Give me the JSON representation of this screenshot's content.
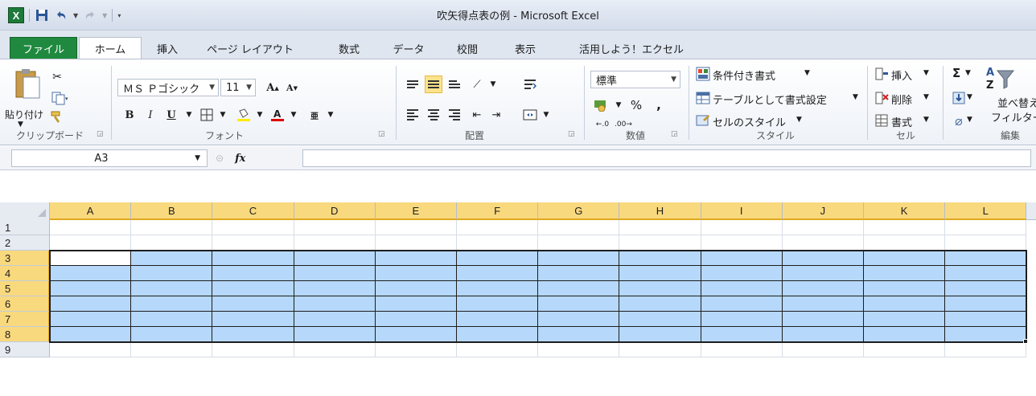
{
  "window": {
    "title": "吹矢得点表の例 - Microsoft Excel",
    "app_icon": "X"
  },
  "tabs": {
    "file": "ファイル",
    "items": [
      "ホーム",
      "挿入",
      "ページ レイアウト",
      "数式",
      "データ",
      "校閲",
      "表示",
      "活用しよう！エクセル"
    ],
    "active": "ホーム"
  },
  "ribbon": {
    "clipboard": {
      "paste": "貼り付け",
      "label": "クリップボード"
    },
    "font": {
      "name": "ＭＳ Ｐゴシック",
      "size": "11",
      "label": "フォント",
      "bold": "B",
      "italic": "I",
      "underline": "U"
    },
    "alignment": {
      "label": "配置"
    },
    "number": {
      "format": "標準",
      "percent": "%",
      "comma": ",",
      "label": "数値",
      "inc_decimal": ".00",
      "dec_decimal": ".00"
    },
    "styles": {
      "conditional": "条件付き書式",
      "table": "テーブルとして書式設定",
      "cell_styles": "セルのスタイル",
      "label": "スタイル"
    },
    "cells": {
      "insert": "挿入",
      "delete": "削除",
      "format": "書式",
      "label": "セル"
    },
    "editing": {
      "sort": "並べ替え",
      "filter": "フィルター",
      "label": "編集",
      "sigma": "Σ"
    }
  },
  "formula_bar": {
    "name_box": "A3",
    "fx": "fx",
    "value": ""
  },
  "grid": {
    "columns": [
      "A",
      "B",
      "C",
      "D",
      "E",
      "F",
      "G",
      "H",
      "I",
      "J",
      "K",
      "L"
    ],
    "rows": [
      "1",
      "2",
      "3",
      "4",
      "5",
      "6",
      "7",
      "8",
      "9"
    ],
    "selected_range": "A3:L8",
    "active_cell": "A3"
  },
  "colors": {
    "file_tab": "#1f8a3f",
    "selection_fill": "#b6d8fa",
    "header_highlight": "#f9d97e"
  }
}
